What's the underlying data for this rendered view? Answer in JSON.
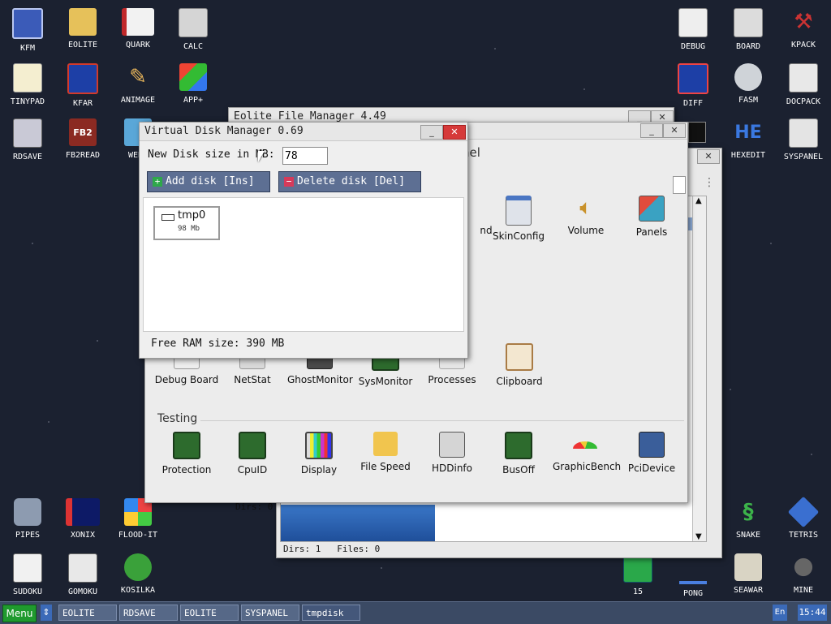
{
  "desktop_left": [
    {
      "label": "KFM"
    },
    {
      "label": "EOLITE"
    },
    {
      "label": "QUARK"
    },
    {
      "label": "CALC"
    },
    {
      "label": "TINYPAD"
    },
    {
      "label": "KFAR"
    },
    {
      "label": "ANIMAGE"
    },
    {
      "label": "APP+"
    },
    {
      "label": "RDSAVE"
    },
    {
      "label": "FB2READ"
    },
    {
      "label": "WEBV"
    }
  ],
  "desktop_right": [
    {
      "label": "DEBUG"
    },
    {
      "label": "BOARD"
    },
    {
      "label": "KPACK"
    },
    {
      "label": "DIFF"
    },
    {
      "label": "FASM"
    },
    {
      "label": "DOCPACK"
    },
    {
      "label": "HEXEDIT"
    },
    {
      "label": "SYSPANEL"
    }
  ],
  "desktop_bottom": [
    {
      "label": "PIPES"
    },
    {
      "label": "XONIX"
    },
    {
      "label": "FLOOD-IT"
    },
    {
      "label": "SUDOKU"
    },
    {
      "label": "GOMOKU"
    },
    {
      "label": "KOSILKA"
    },
    {
      "label": "SNAKE"
    },
    {
      "label": "TETRIS"
    },
    {
      "label": "15"
    },
    {
      "label": "PONG"
    },
    {
      "label": "SEAWAR"
    },
    {
      "label": "MINE"
    }
  ],
  "icon_text": {
    "fb2": "FB2",
    "he": "HE"
  },
  "eolite_back": {
    "title": "Eolite File Manager 4.49",
    "status": "Dirs: 1   Files: 0",
    "min": "_",
    "close": "✕"
  },
  "syspanel": {
    "header_fragment": "nel",
    "dirs_label": "Dirs: 0",
    "top_row": [
      "nd",
      "SkinConfig",
      "Volume",
      "Panels"
    ],
    "middle_row": [
      "Debug Board",
      "NetStat",
      "GhostMonitor",
      "SysMonitor",
      "Processes",
      "Clipboard"
    ],
    "testing_heading": "Testing",
    "testing_row": [
      "Protection",
      "CpuID",
      "Display",
      "File Speed",
      "HDDinfo",
      "BusOff",
      "GraphicBench",
      "PciDevice"
    ],
    "min": "_",
    "close": "✕"
  },
  "vdm": {
    "title": "Virtual Disk Manager 0.69",
    "size_label": "New Disk size in MB:",
    "size_value": "78",
    "add_label": "Add disk [Ins]",
    "delete_label": "Delete disk [Del]",
    "disk_name": "tmp0",
    "disk_size": "98 Mb",
    "free_ram": "Free RAM size: 390 MB",
    "min": "_",
    "close": "✕"
  },
  "taskbar": {
    "menu": "Menu",
    "arrows": "⇕",
    "buttons": [
      "EOLITE",
      "RDSAVE",
      "EOLITE",
      "SYSPANEL",
      "tmpdisk"
    ],
    "lang": "En",
    "time": "15:44"
  },
  "colors": {
    "menu_green": "#1f9a2e",
    "taskbar": "#3b4a64",
    "close_red": "#d63a3a",
    "button_blue": "#5d6f93"
  }
}
